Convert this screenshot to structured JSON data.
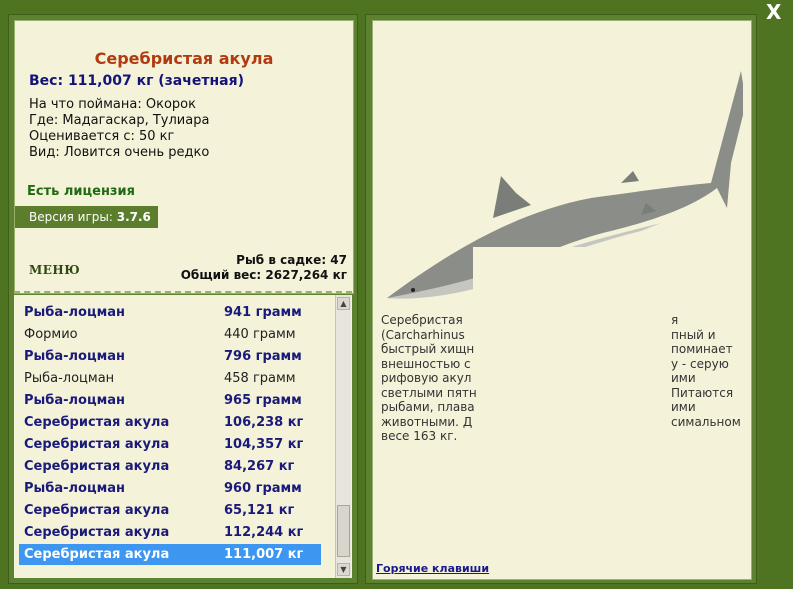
{
  "fish": {
    "title": "Серебристая акула",
    "weight": "Вес: 111,007 кг (зачетная)",
    "bait": "На что поймана: Окорок",
    "location": "Где: Мадагаскар, Тулиара",
    "value": "Оценивается с: 50 кг",
    "rarity": "Вид: Ловится очень редко"
  },
  "license": "Есть лицензия",
  "version": {
    "label": "Версия игры:",
    "value": "3.7.6"
  },
  "menu_label": "МЕНЮ",
  "stats": {
    "fish_count": "Рыб в садке: 47",
    "total_weight": "Общий вес: 2627,264 кг"
  },
  "catch_list": [
    {
      "name": "Рыба-лоцман",
      "weight": "941 грамм",
      "style": "bold"
    },
    {
      "name": "Формио",
      "weight": "440 грамм",
      "style": "normal"
    },
    {
      "name": "Рыба-лоцман",
      "weight": "796 грамм",
      "style": "bold"
    },
    {
      "name": "Рыба-лоцман",
      "weight": "458 грамм",
      "style": "normal"
    },
    {
      "name": "Рыба-лоцман",
      "weight": "965 грамм",
      "style": "bold"
    },
    {
      "name": "Серебристая акула",
      "weight": "106,238 кг",
      "style": "bold"
    },
    {
      "name": "Серебристая акула",
      "weight": "104,357 кг",
      "style": "bold"
    },
    {
      "name": "Серебристая акула",
      "weight": "84,267 кг",
      "style": "bold"
    },
    {
      "name": "Рыба-лоцман",
      "weight": "960 грамм",
      "style": "bold"
    },
    {
      "name": "Серебристая акула",
      "weight": "65,121 кг",
      "style": "bold"
    },
    {
      "name": "Серебристая акула",
      "weight": "112,244 кг",
      "style": "bold"
    },
    {
      "name": "Серебристая акула",
      "weight": "111,007 кг",
      "style": "sel"
    }
  ],
  "description": [
    "Серебристая",
    "(Carcharhinus",
    "быстрый хищн",
    "внешностью с",
    "рифовую акул",
    "светлыми пятн",
    "рыбами, плава",
    "животными. Д",
    "весе 163 кг."
  ],
  "description_right": [
    "я",
    "пный и",
    "поминает",
    "у - серую",
    "ими",
    "Питаются",
    "ими",
    "симальном"
  ],
  "hotkeys_label": "Горячие клавиши",
  "close_label": "X",
  "icons": {
    "close": "close-icon"
  }
}
